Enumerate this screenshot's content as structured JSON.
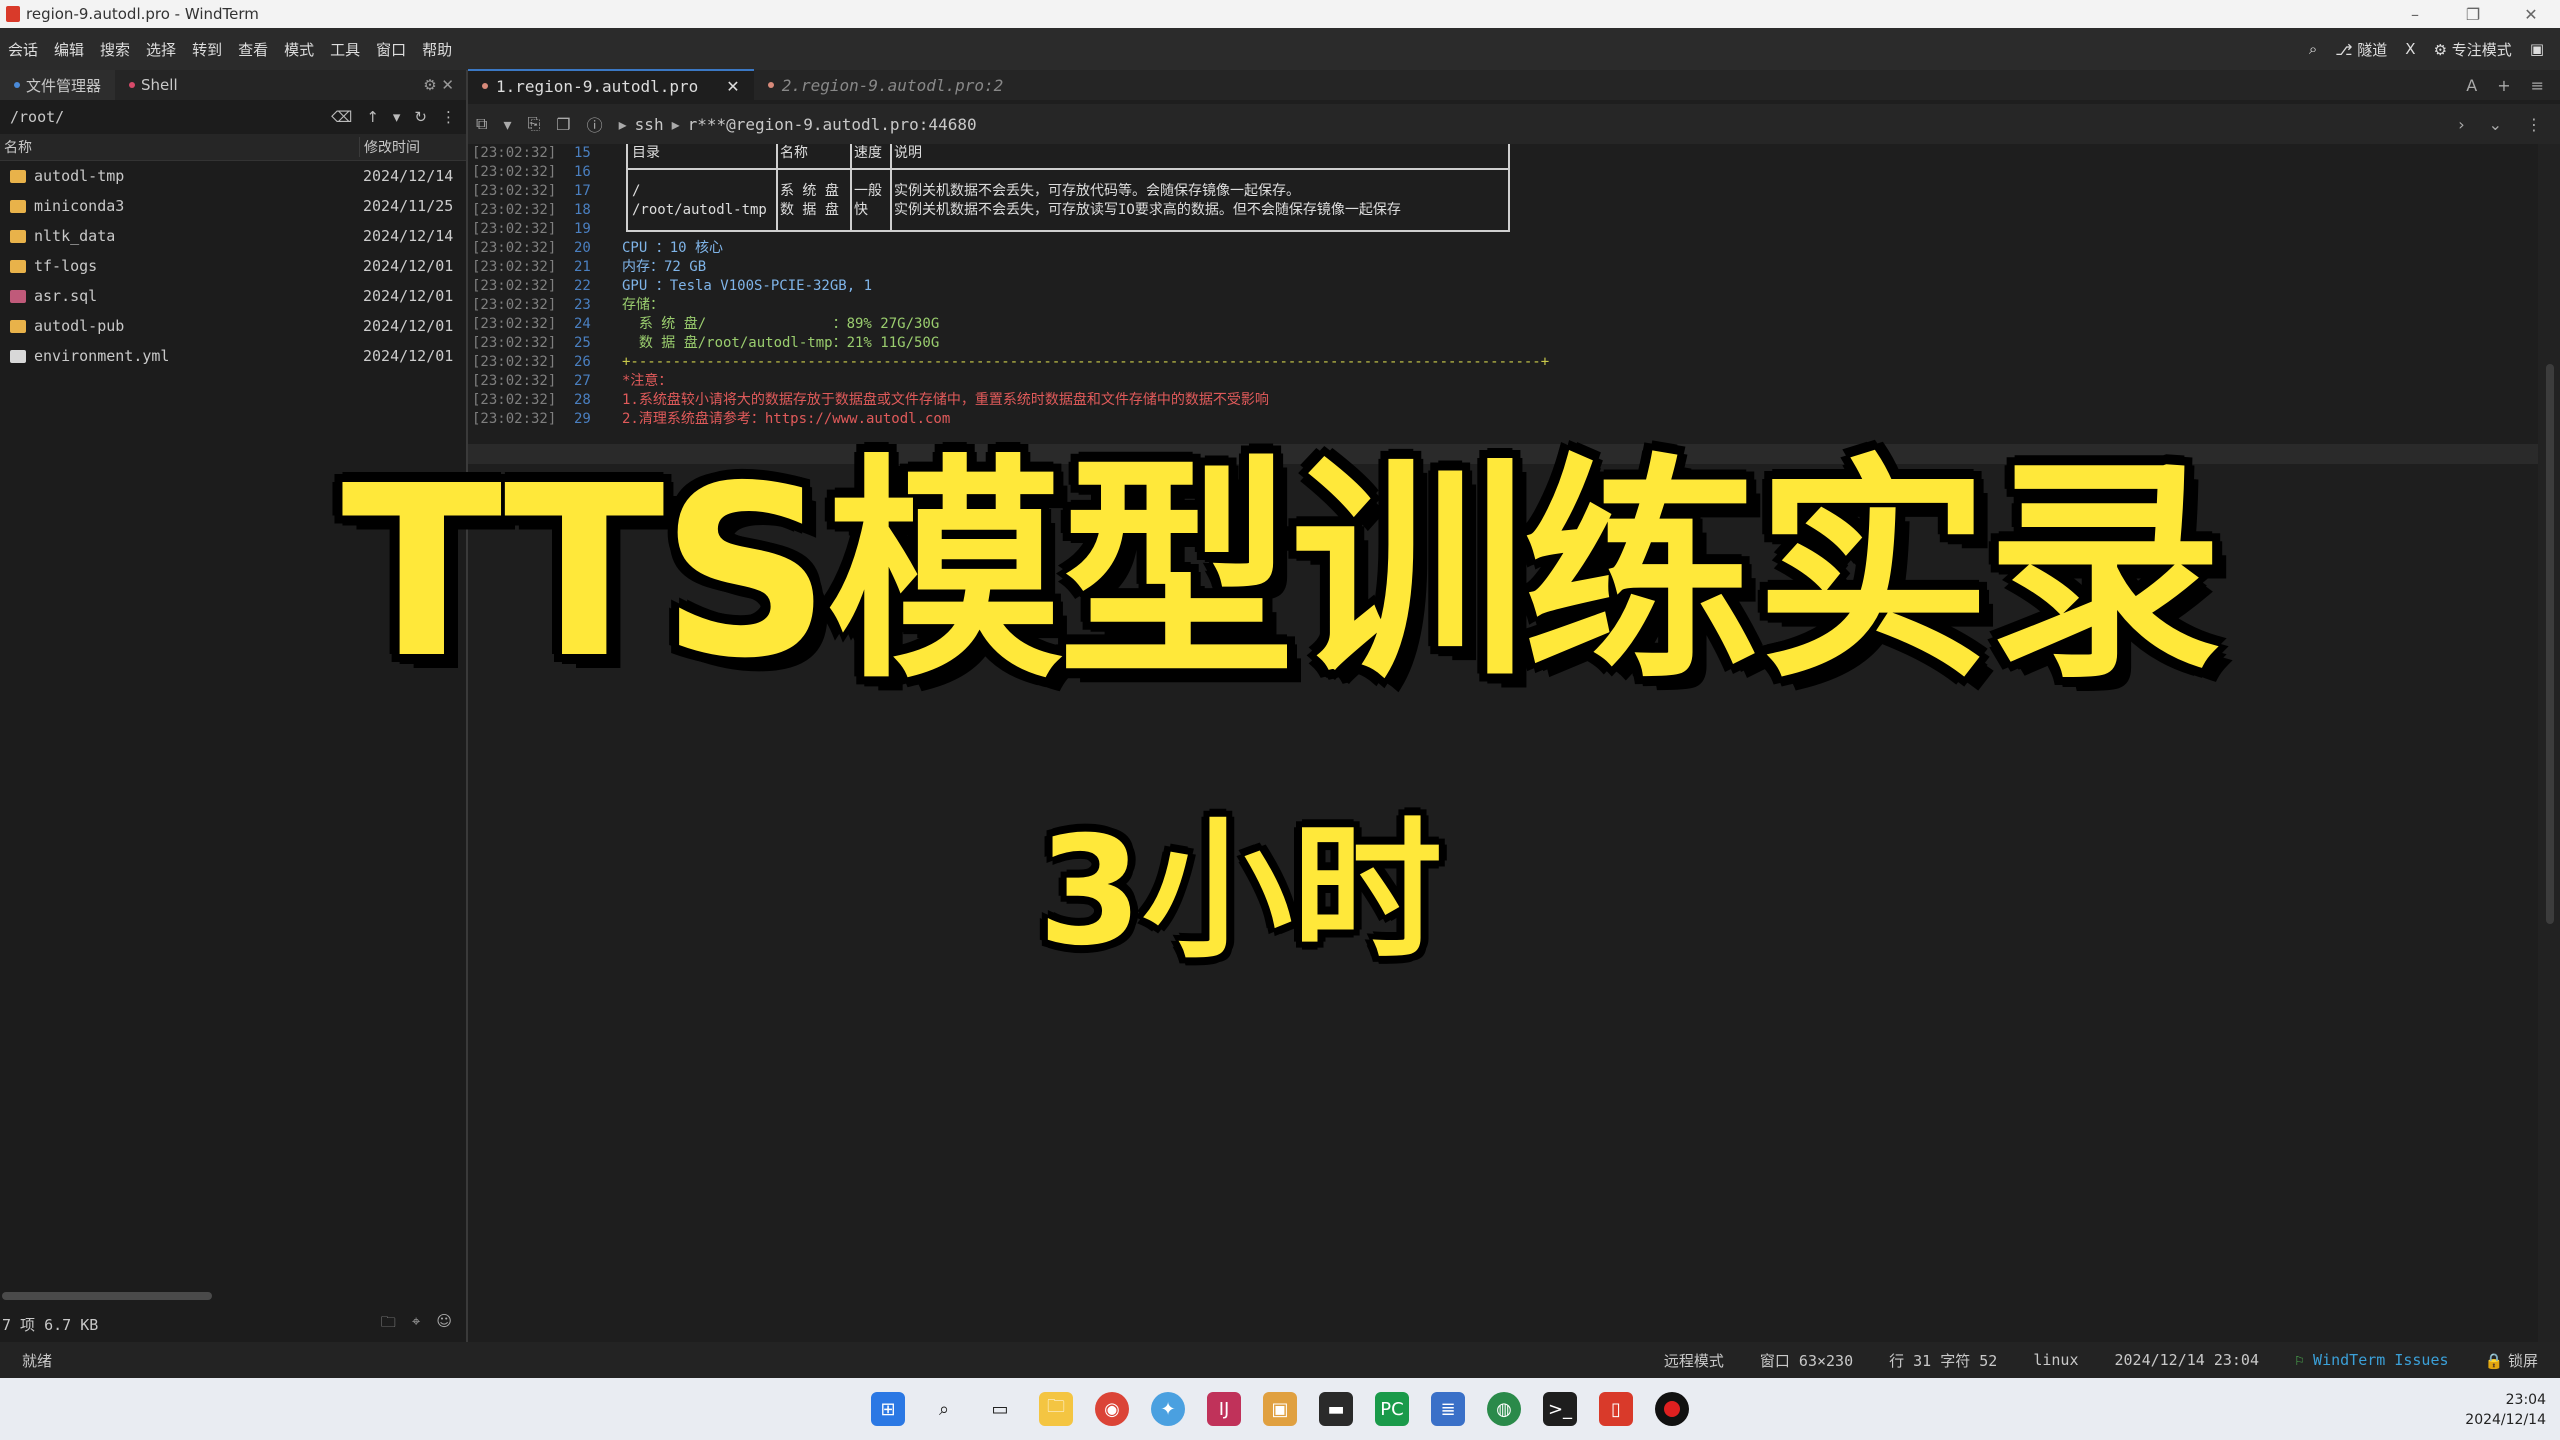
{
  "window": {
    "title": "region-9.autodl.pro - WindTerm"
  },
  "menu": {
    "items": [
      "会话",
      "编辑",
      "搜索",
      "选择",
      "转到",
      "查看",
      "模式",
      "工具",
      "窗口",
      "帮助"
    ],
    "tunnel": "隧道",
    "focus_mode": "专注模式"
  },
  "left": {
    "tab_files": "文件管理器",
    "tab_shell": "Shell",
    "path": "/root/",
    "col_name": "名称",
    "col_mtime": "修改时间",
    "files": [
      {
        "name": "autodl-tmp",
        "date": "2024/12/14",
        "type": "folder"
      },
      {
        "name": "miniconda3",
        "date": "2024/11/25",
        "type": "folder"
      },
      {
        "name": "nltk_data",
        "date": "2024/12/14",
        "type": "folder"
      },
      {
        "name": "tf-logs",
        "date": "2024/12/01",
        "type": "folder"
      },
      {
        "name": "asr.sql",
        "date": "2024/12/01",
        "type": "sql"
      },
      {
        "name": "autodl-pub",
        "date": "2024/12/01",
        "type": "folder-link"
      },
      {
        "name": "environment.yml",
        "date": "2024/12/01",
        "type": "file"
      }
    ],
    "footer": "7 项 6.7 KB"
  },
  "tabs": [
    {
      "label": "1.region-9.autodl.pro",
      "active": true
    },
    {
      "label": "2.region-9.autodl.pro:2",
      "active": false
    }
  ],
  "address": {
    "protocol": "ssh",
    "host": "r***@region-9.autodl.pro:44680"
  },
  "terminal": {
    "lines": [
      {
        "ts": "[23:02:32]",
        "n": "15",
        "text": "",
        "color": "#c8c8c8"
      },
      {
        "ts": "[23:02:32]",
        "n": "16",
        "text": "",
        "color": "#c8c8c8"
      },
      {
        "ts": "[23:02:32]",
        "n": "17",
        "text": "",
        "color": "#c8c8c8"
      },
      {
        "ts": "[23:02:32]",
        "n": "18",
        "text": "",
        "color": "#c8c8c8"
      },
      {
        "ts": "[23:02:32]",
        "n": "19",
        "text": "",
        "color": "#c8c8c8"
      },
      {
        "ts": "[23:02:32]",
        "n": "20",
        "text": "CPU ：10 核心",
        "color": "#7fb4e8"
      },
      {
        "ts": "[23:02:32]",
        "n": "21",
        "text": "内存：72 GB",
        "color": "#7fb4e8"
      },
      {
        "ts": "[23:02:32]",
        "n": "22",
        "text": "GPU ：Tesla V100S-PCIE-32GB, 1",
        "color": "#7fb4e8"
      },
      {
        "ts": "[23:02:32]",
        "n": "23",
        "text": "存储：",
        "color": "#9acd6e"
      },
      {
        "ts": "[23:02:32]",
        "n": "24",
        "text": "  系 统 盘/               ：89% 27G/30G",
        "color": "#9acd6e"
      },
      {
        "ts": "[23:02:32]",
        "n": "25",
        "text": "  数 据 盘/root/autodl-tmp：21% 11G/50G",
        "color": "#9acd6e"
      },
      {
        "ts": "[23:02:32]",
        "n": "26",
        "text": "+------------------------------------------------------------------------------------------------------------+",
        "color": "#c9c94a"
      },
      {
        "ts": "[23:02:32]",
        "n": "27",
        "text": "*注意：",
        "color": "#e05a5a"
      },
      {
        "ts": "[23:02:32]",
        "n": "28",
        "text": "1.系统盘较小请将大的数据存放于数据盘或文件存储中，重置系统时数据盘和文件存储中的数据不受影响",
        "color": "#e05a5a"
      },
      {
        "ts": "[23:02:32]",
        "n": "29",
        "text": "2.清理系统盘请参考：https://www.autodl.com",
        "color": "#e05a5a"
      }
    ],
    "table": {
      "headers": [
        "目录",
        "名称",
        "速度",
        "说明"
      ],
      "rows": [
        [
          "/",
          "系 统 盘",
          "一般",
          "实例关机数据不会丢失，可存放代码等。会随保存镜像一起保存。"
        ],
        [
          "/root/autodl-tmp",
          "数 据 盘",
          "快",
          "实例关机数据不会丢失，可存放读写IO要求高的数据。但不会随保存镜像一起保存"
        ]
      ]
    }
  },
  "status": {
    "ready": "就绪",
    "mode": "远程模式",
    "window": "窗口 63×230",
    "pos": "行 31 字符 52",
    "os": "linux",
    "datetime": "2024/12/14 23:04",
    "issues": "WindTerm Issues",
    "lock": "锁屏"
  },
  "clock": {
    "time": "23:04",
    "date": "2024/12/14"
  },
  "overlay": {
    "title": "TTS模型训练实录",
    "subtitle": "3小时"
  }
}
